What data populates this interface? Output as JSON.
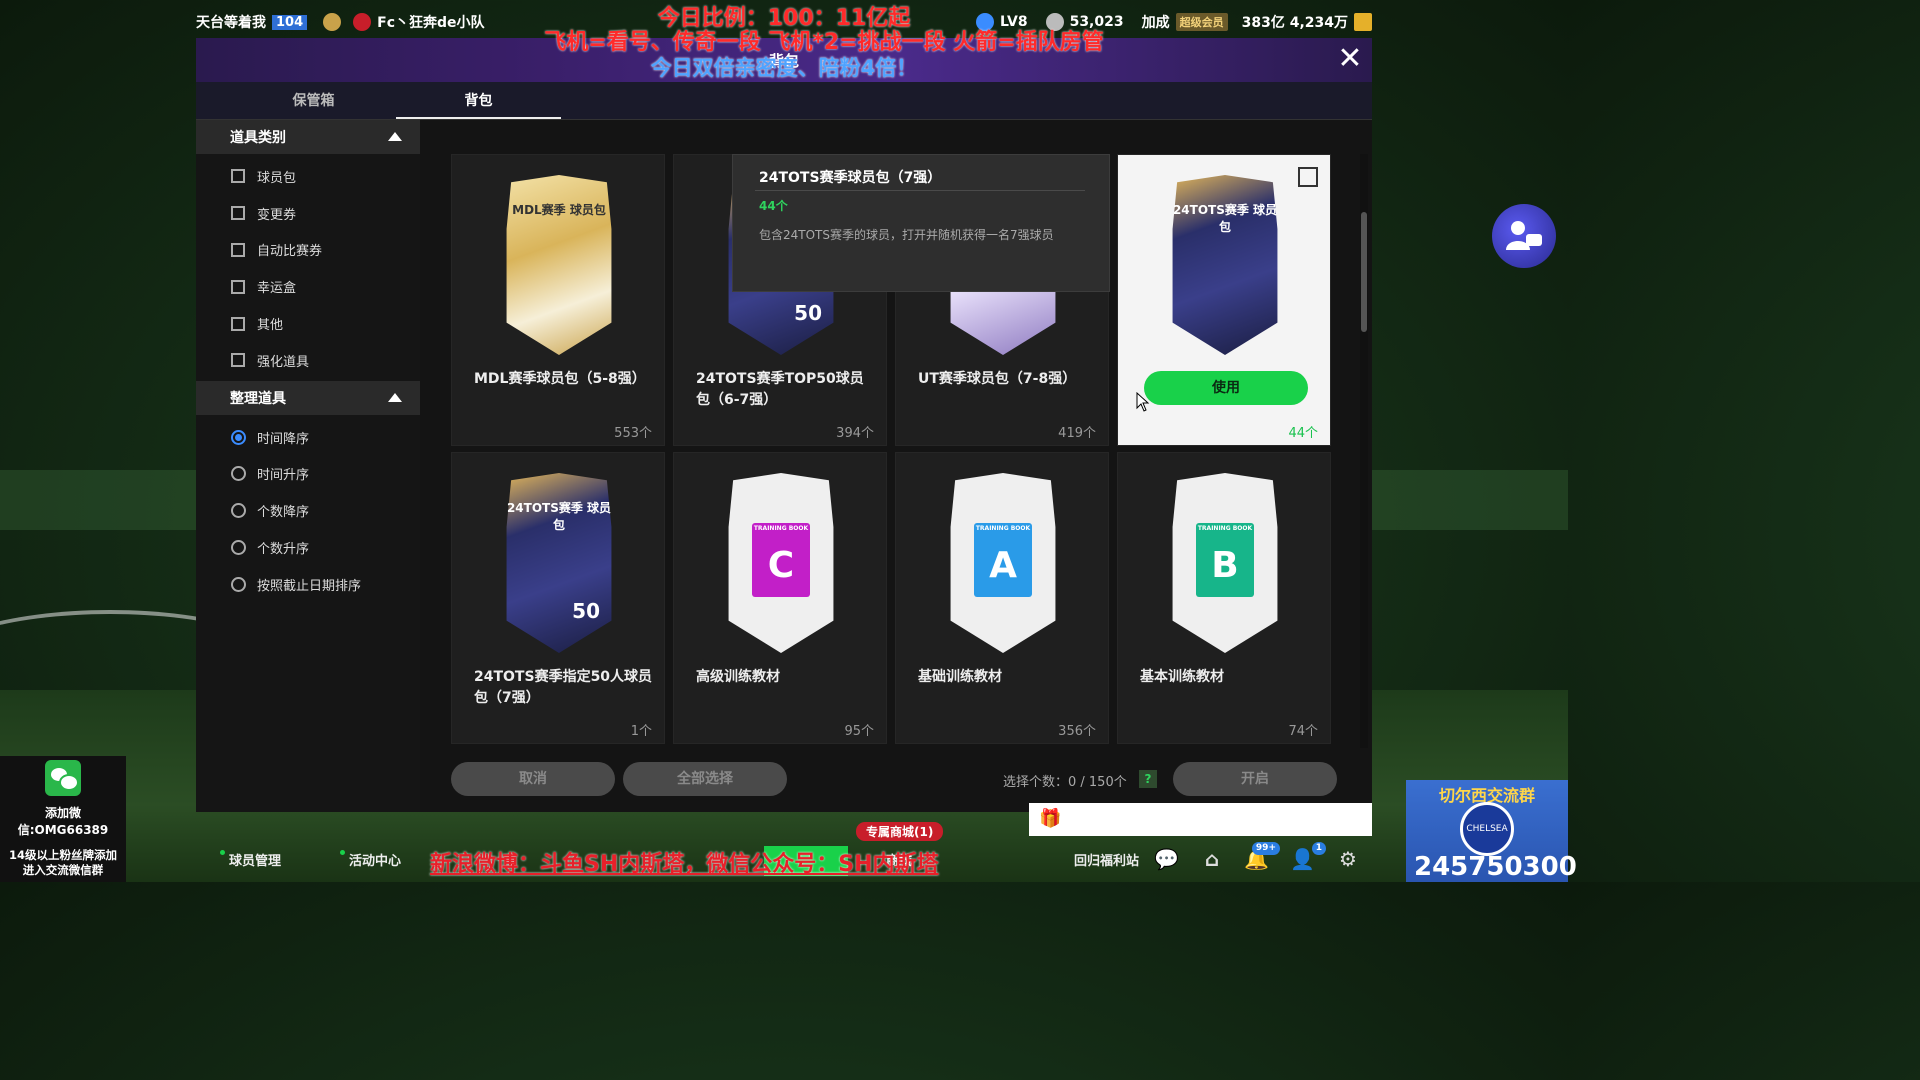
{
  "topbar": {
    "player_name": "天台等着我",
    "player_level": "104",
    "club_name": "Fc丶狂奔de小队",
    "lv": "LV8",
    "points": "53,023",
    "buff_label": "加成",
    "vip_label": "超级会员",
    "coins": "383亿 4,234万"
  },
  "promo": {
    "line1": "今日比例：100：11亿起",
    "line2": "飞机=看号、传奇一段 飞机*2=挑战一段 火箭=插队房管",
    "line3": "今日双倍亲密度、陪粉4倍！"
  },
  "window": {
    "title": "背包",
    "tabs": [
      "保管箱",
      "背包"
    ]
  },
  "sidebar": {
    "category_title": "道具类别",
    "categories": [
      "球员包",
      "变更券",
      "自动比赛券",
      "幸运盒",
      "其他",
      "强化道具"
    ],
    "sort_title": "整理道具",
    "sorts": [
      "时间降序",
      "时间升序",
      "个数降序",
      "个数升序",
      "按照截止日期排序"
    ]
  },
  "items": [
    {
      "name": "MDL赛季球员包（5-8强）",
      "count": "553个",
      "art_label": "MDL赛季 球员包"
    },
    {
      "name": "24TOTS赛季TOP50球员包（6-7强）",
      "count": "394个",
      "art_label": "",
      "big": "50"
    },
    {
      "name": "UT赛季球员包（7-8强）",
      "count": "419个",
      "art_label": ""
    },
    {
      "name": "24TOTS赛季球员包（7强）",
      "count": "44个",
      "art_label": "24TOTS赛季 球员包",
      "use_label": "使用"
    },
    {
      "name": "24TOTS赛季指定50人球员包（7强）",
      "count": "1个",
      "art_label": "24TOTS赛季 球员包",
      "big": "50"
    },
    {
      "name": "高级训练教材",
      "count": "95个",
      "letter": "C",
      "book_label": "TRAINING BOOK"
    },
    {
      "name": "基础训练教材",
      "count": "356个",
      "letter": "A",
      "book_label": "TRAINING BOOK"
    },
    {
      "name": "基本训练教材",
      "count": "74个",
      "letter": "B",
      "book_label": "TRAINING BOOK"
    }
  ],
  "tooltip": {
    "title": "24TOTS赛季球员包（7强）",
    "count": "44个",
    "desc": "包含24TOTS赛季的球员，打开并随机获得一名7强球员"
  },
  "footer": {
    "cancel": "取消",
    "select_all": "全部选择",
    "selected": "选择个数：0 / 150个",
    "help": "?",
    "open": "开启"
  },
  "bottomnav": {
    "player_manage": "球员管理",
    "activity_center": "活动中心",
    "shop": "商城",
    "exclusive_shop": "专属商城(1)",
    "welfare": "回归福利站",
    "notif_count": "99+",
    "friend_count": "1"
  },
  "bottom_promo": "新浪微博：斗鱼SH内斯塔，微信公众号：SH内斯塔",
  "wechat": {
    "line1": "添加微信:OMG66389",
    "line2": "14级以上粉丝牌添加",
    "line3": "进入交流微信群"
  },
  "club": {
    "name": "切尔西交流群",
    "crest_text": "CHELSEA",
    "number": "245750300"
  },
  "colors": {
    "accent_green": "#19d14a",
    "radio_blue": "#3b8cff",
    "banner_purple": "#3a1f6a"
  }
}
